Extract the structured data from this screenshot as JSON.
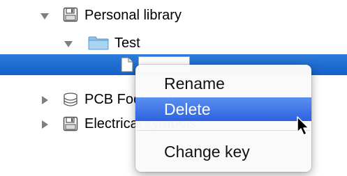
{
  "tree": {
    "items": [
      {
        "label": "Personal library",
        "expanded": true,
        "icon": "floppy-disk-icon"
      },
      {
        "label": "Test",
        "expanded": true,
        "icon": "folder-icon"
      },
      {
        "label": "",
        "selected": true,
        "editing": true,
        "edit_value": "",
        "icon": "document-icon"
      },
      {
        "label": "PCB Footprints",
        "expanded": false,
        "icon": "database-icon"
      },
      {
        "label": "Electrical symbols",
        "expanded": false,
        "icon": "floppy-disk-icon"
      }
    ]
  },
  "context_menu": {
    "items": [
      {
        "label": "Rename",
        "highlighted": false
      },
      {
        "label": "Delete",
        "highlighted": true
      },
      {
        "label": "Change key",
        "highlighted": false
      }
    ]
  },
  "colors": {
    "selection": "#1a66d0",
    "menu_highlight": "#3d72e8"
  }
}
